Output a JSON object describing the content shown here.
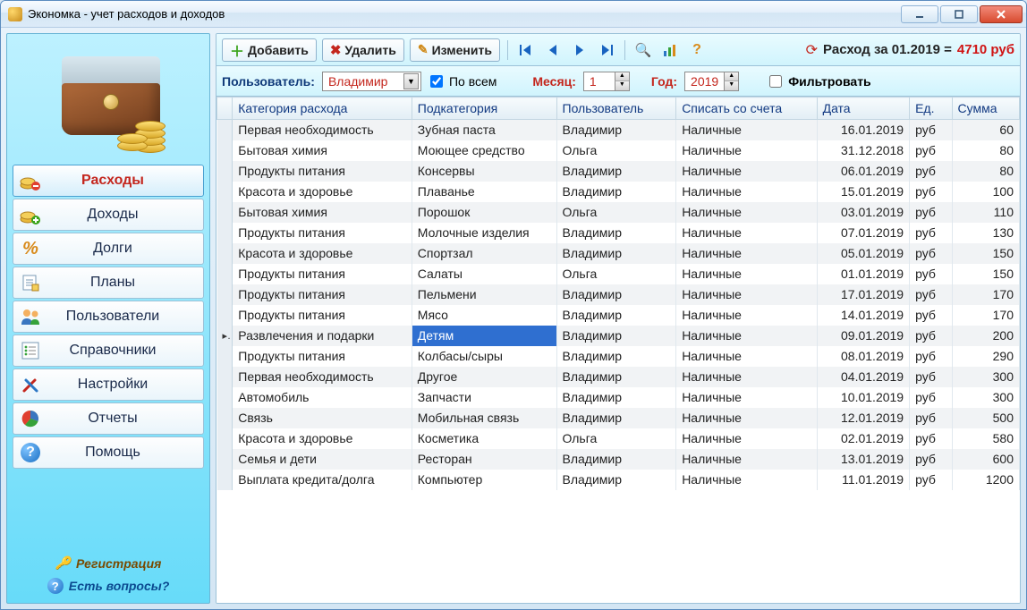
{
  "window": {
    "title": "Экономка - учет расходов и доходов"
  },
  "toolbar": {
    "add": "Добавить",
    "delete": "Удалить",
    "edit": "Изменить"
  },
  "summary": {
    "prefix": "Расход за 01.2019 =",
    "amount": "4710 руб"
  },
  "filters": {
    "user_label": "Пользователь:",
    "user_value": "Владимир",
    "all_label": "По всем",
    "all_checked": true,
    "month_label": "Месяц:",
    "month_value": "1",
    "year_label": "Год:",
    "year_value": "2019",
    "filter_label": "Фильтровать",
    "filter_checked": false
  },
  "sidebar": {
    "items": [
      {
        "label": "Расходы",
        "icon": "coins-minus"
      },
      {
        "label": "Доходы",
        "icon": "coins-plus"
      },
      {
        "label": "Долги",
        "icon": "percent"
      },
      {
        "label": "Планы",
        "icon": "notes"
      },
      {
        "label": "Пользователи",
        "icon": "users"
      },
      {
        "label": "Справочники",
        "icon": "list"
      },
      {
        "label": "Настройки",
        "icon": "tools"
      },
      {
        "label": "Отчеты",
        "icon": "piechart"
      },
      {
        "label": "Помощь",
        "icon": "help"
      }
    ],
    "register": "Регистрация",
    "faq": "Есть вопросы?"
  },
  "columns": {
    "category": "Категория расхода",
    "subcategory": "Подкатегория",
    "user": "Пользователь",
    "account": "Списать со счета",
    "date": "Дата",
    "unit": "Ед.",
    "sum": "Сумма"
  },
  "rows": [
    {
      "cat": "Первая необходимость",
      "sub": "Зубная паста",
      "user": "Владимир",
      "acc": "Наличные",
      "date": "16.01.2019",
      "unit": "руб",
      "sum": "60"
    },
    {
      "cat": "Бытовая химия",
      "sub": "Моющее средство",
      "user": "Ольга",
      "acc": "Наличные",
      "date": "31.12.2018",
      "unit": "руб",
      "sum": "80"
    },
    {
      "cat": "Продукты питания",
      "sub": "Консервы",
      "user": "Владимир",
      "acc": "Наличные",
      "date": "06.01.2019",
      "unit": "руб",
      "sum": "80"
    },
    {
      "cat": "Красота и здоровье",
      "sub": "Плаванье",
      "user": "Владимир",
      "acc": "Наличные",
      "date": "15.01.2019",
      "unit": "руб",
      "sum": "100"
    },
    {
      "cat": "Бытовая химия",
      "sub": "Порошок",
      "user": "Ольга",
      "acc": "Наличные",
      "date": "03.01.2019",
      "unit": "руб",
      "sum": "110"
    },
    {
      "cat": "Продукты питания",
      "sub": "Молочные изделия",
      "user": "Владимир",
      "acc": "Наличные",
      "date": "07.01.2019",
      "unit": "руб",
      "sum": "130"
    },
    {
      "cat": "Красота и здоровье",
      "sub": "Спортзал",
      "user": "Владимир",
      "acc": "Наличные",
      "date": "05.01.2019",
      "unit": "руб",
      "sum": "150"
    },
    {
      "cat": "Продукты питания",
      "sub": "Салаты",
      "user": "Ольга",
      "acc": "Наличные",
      "date": "01.01.2019",
      "unit": "руб",
      "sum": "150"
    },
    {
      "cat": "Продукты питания",
      "sub": "Пельмени",
      "user": "Владимир",
      "acc": "Наличные",
      "date": "17.01.2019",
      "unit": "руб",
      "sum": "170"
    },
    {
      "cat": "Продукты питания",
      "sub": "Мясо",
      "user": "Владимир",
      "acc": "Наличные",
      "date": "14.01.2019",
      "unit": "руб",
      "sum": "170"
    },
    {
      "cat": "Развлечения и подарки",
      "sub": "Детям",
      "user": "Владимир",
      "acc": "Наличные",
      "date": "09.01.2019",
      "unit": "руб",
      "sum": "200",
      "selected": true
    },
    {
      "cat": "Продукты питания",
      "sub": "Колбасы/сыры",
      "user": "Владимир",
      "acc": "Наличные",
      "date": "08.01.2019",
      "unit": "руб",
      "sum": "290"
    },
    {
      "cat": "Первая необходимость",
      "sub": "Другое",
      "user": "Владимир",
      "acc": "Наличные",
      "date": "04.01.2019",
      "unit": "руб",
      "sum": "300"
    },
    {
      "cat": "Автомобиль",
      "sub": "Запчасти",
      "user": "Владимир",
      "acc": "Наличные",
      "date": "10.01.2019",
      "unit": "руб",
      "sum": "300"
    },
    {
      "cat": "Связь",
      "sub": "Мобильная связь",
      "user": "Владимир",
      "acc": "Наличные",
      "date": "12.01.2019",
      "unit": "руб",
      "sum": "500"
    },
    {
      "cat": "Красота и здоровье",
      "sub": "Косметика",
      "user": "Ольга",
      "acc": "Наличные",
      "date": "02.01.2019",
      "unit": "руб",
      "sum": "580"
    },
    {
      "cat": "Семья и дети",
      "sub": "Ресторан",
      "user": "Владимир",
      "acc": "Наличные",
      "date": "13.01.2019",
      "unit": "руб",
      "sum": "600"
    },
    {
      "cat": "Выплата кредита/долга",
      "sub": "Компьютер",
      "user": "Владимир",
      "acc": "Наличные",
      "date": "11.01.2019",
      "unit": "руб",
      "sum": "1200"
    }
  ]
}
